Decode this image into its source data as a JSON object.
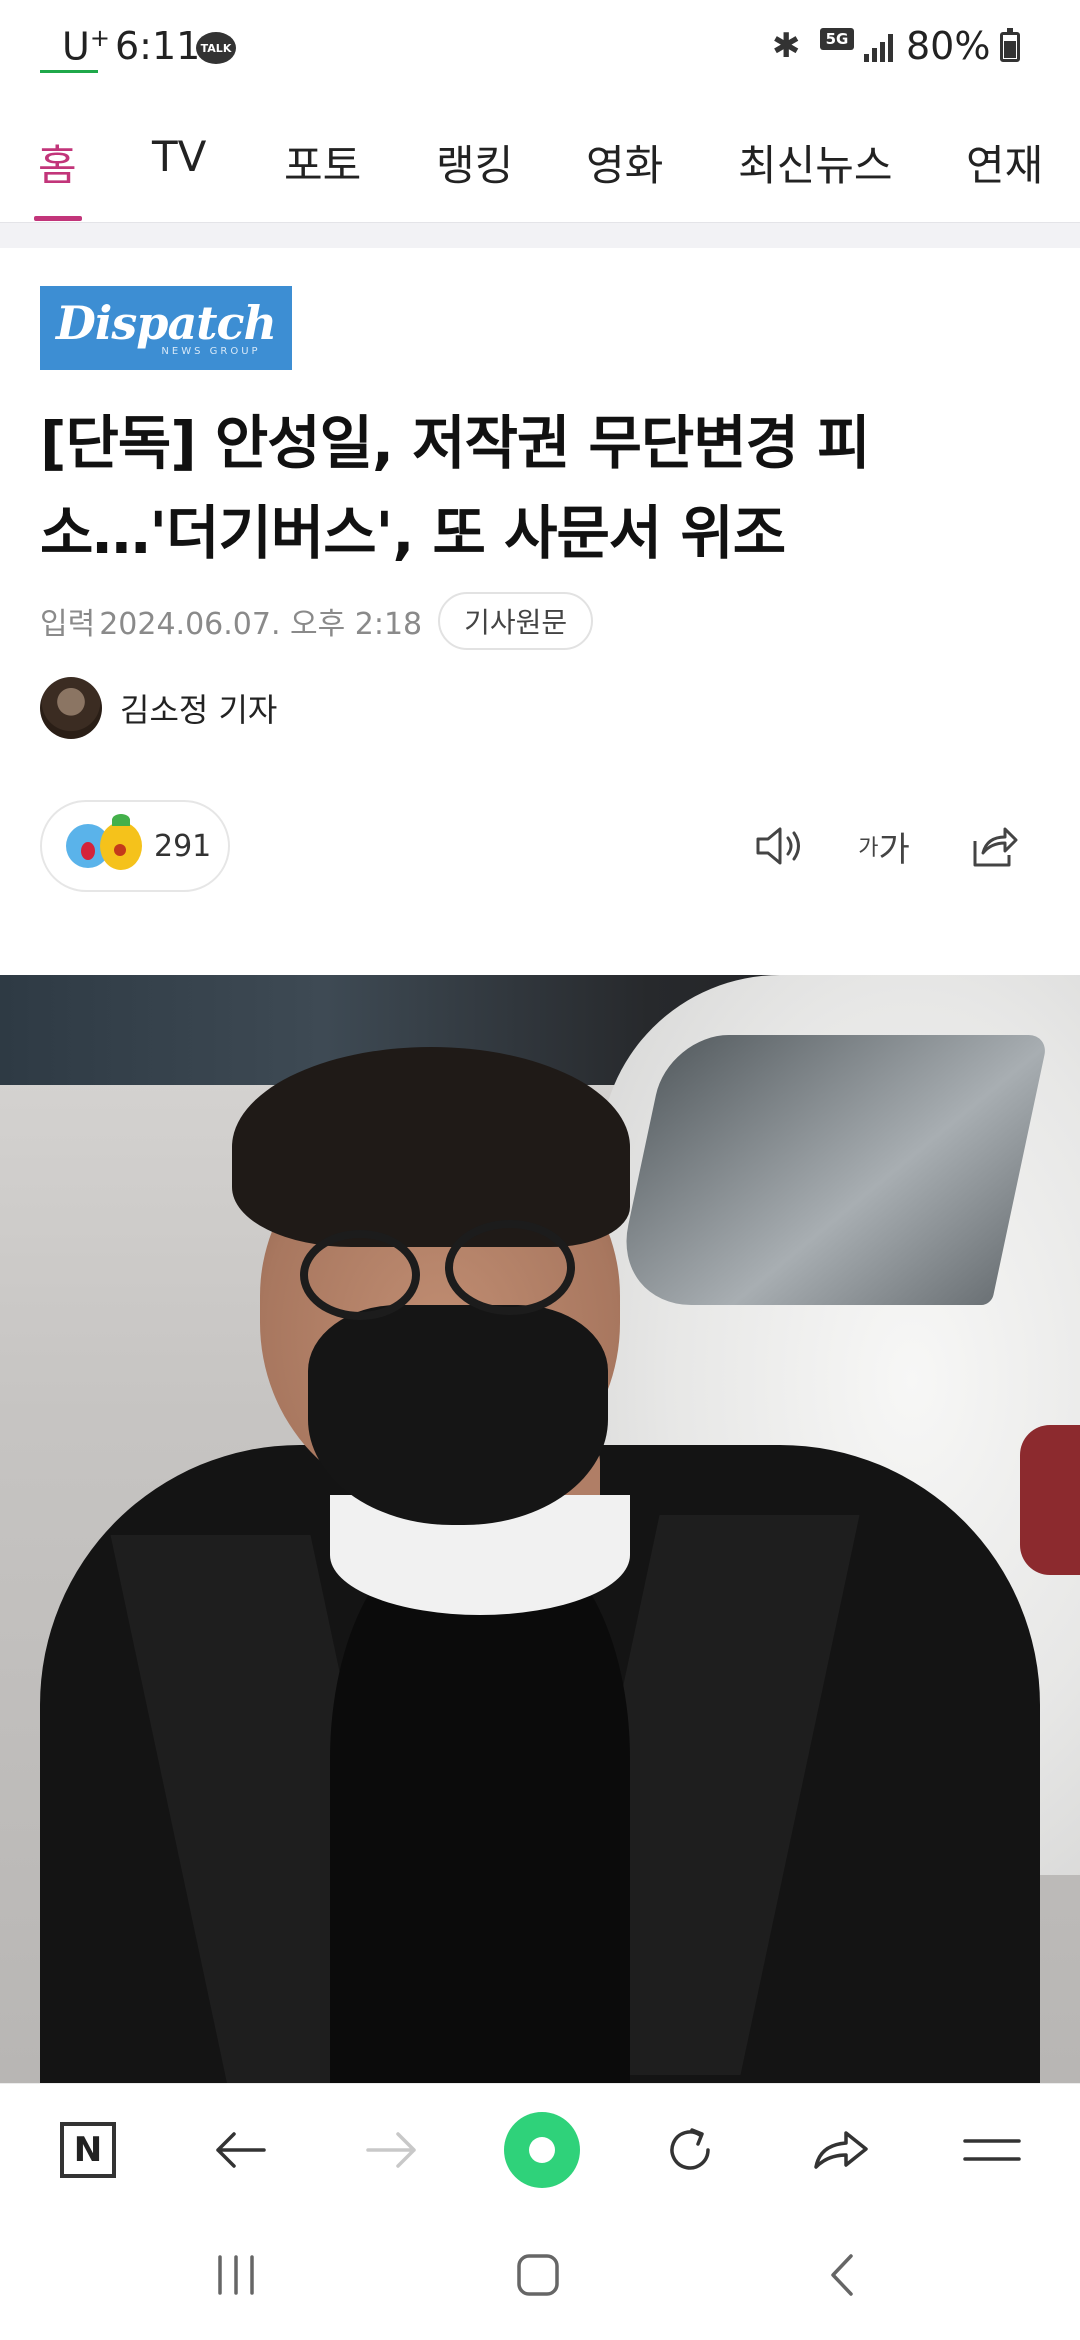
{
  "status_bar": {
    "carrier": "U",
    "carrier_plus": "+",
    "time": "6:11",
    "talk_badge": "TALK",
    "network": "5G",
    "battery": "80%"
  },
  "nav": {
    "tabs": [
      "홈",
      "TV",
      "포토",
      "랭킹",
      "영화",
      "최신뉴스",
      "연재"
    ],
    "active_index": 0,
    "accent_color": "#c2357a"
  },
  "article": {
    "source_logo_text": "Dispatch",
    "source_logo_sub": "NEWS GROUP",
    "headline_line1": "[단독] 안성일, 저작권 무단변경 피",
    "headline_line2": "소…'더기버스', 또 사문서 위조",
    "meta_label": "입력",
    "meta_date": "2024.06.07. 오후 2:18",
    "original_button": "기사원문",
    "reporter": "김소정 기자",
    "reaction_count": "291"
  },
  "toolbar_icons": {
    "tts": "speaker-icon",
    "font_size_small": "가",
    "font_size_large": "가",
    "share": "share-icon"
  },
  "browser_bar": {
    "home_letter": "N",
    "icons": [
      "naver-home-icon",
      "back-arrow-icon",
      "forward-arrow-icon",
      "green-dot-icon",
      "reload-icon",
      "share-arrow-icon",
      "menu-icon"
    ]
  },
  "system_nav": {
    "icons": [
      "recent-apps-icon",
      "home-icon",
      "back-icon"
    ]
  }
}
